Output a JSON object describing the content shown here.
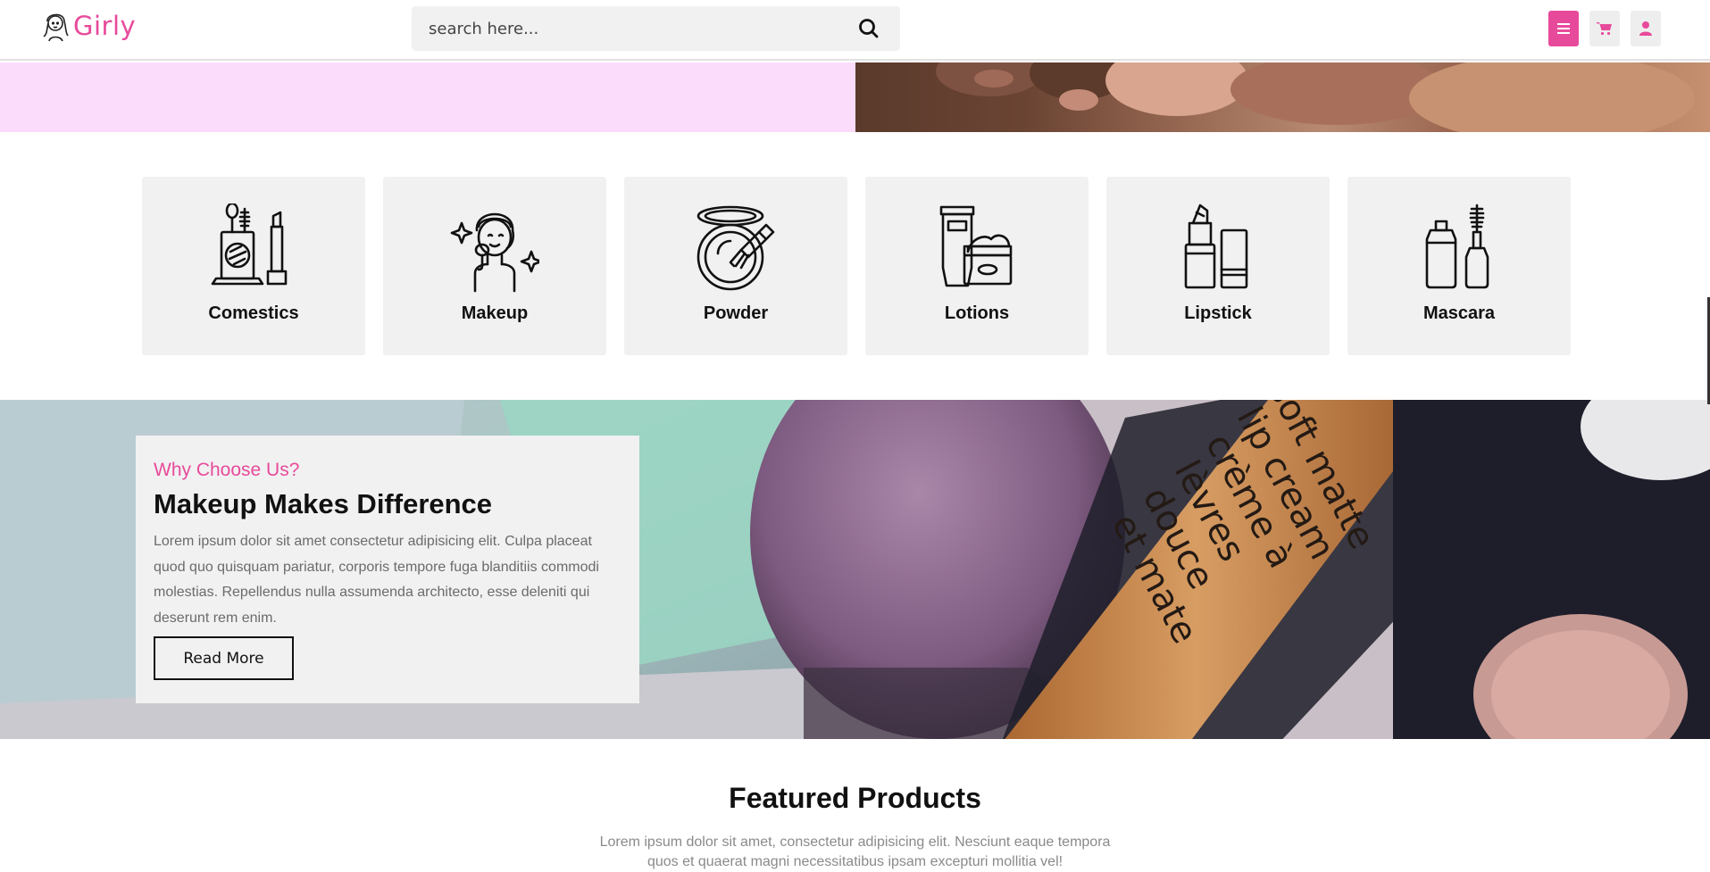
{
  "header": {
    "logo_text": "Girly",
    "search_placeholder": "search here...",
    "accent_color": "#e84a9b",
    "icons": [
      "search-icon",
      "menu-icon",
      "cart-icon",
      "user-icon"
    ]
  },
  "categories": [
    {
      "label": "Comestics",
      "icon": "cosmetics-icon"
    },
    {
      "label": "Makeup",
      "icon": "makeup-face-icon"
    },
    {
      "label": "Powder",
      "icon": "powder-compact-icon"
    },
    {
      "label": "Lotions",
      "icon": "lotion-tube-jar-icon"
    },
    {
      "label": "Lipstick",
      "icon": "lipstick-icon"
    },
    {
      "label": "Mascara",
      "icon": "mascara-icon"
    }
  ],
  "why": {
    "kicker": "Why Choose Us?",
    "title": "Makeup Makes Difference",
    "text": "Lorem ipsum dolor sit amet consectetur adipisicing elit. Culpa placeat quod quo quisquam pariatur, corporis tempore fuga blanditiis commodi molestias. Repellendus nulla assumenda architecto, esse deleniti qui deserunt rem enim.",
    "button_label": "Read More"
  },
  "featured": {
    "title": "Featured Products",
    "text": "Lorem ipsum dolor sit amet, consectetur adipisicing elit. Nesciunt eaque tempora quos et quaerat magni necessitatibus ipsam excepturi mollitia vel!"
  }
}
